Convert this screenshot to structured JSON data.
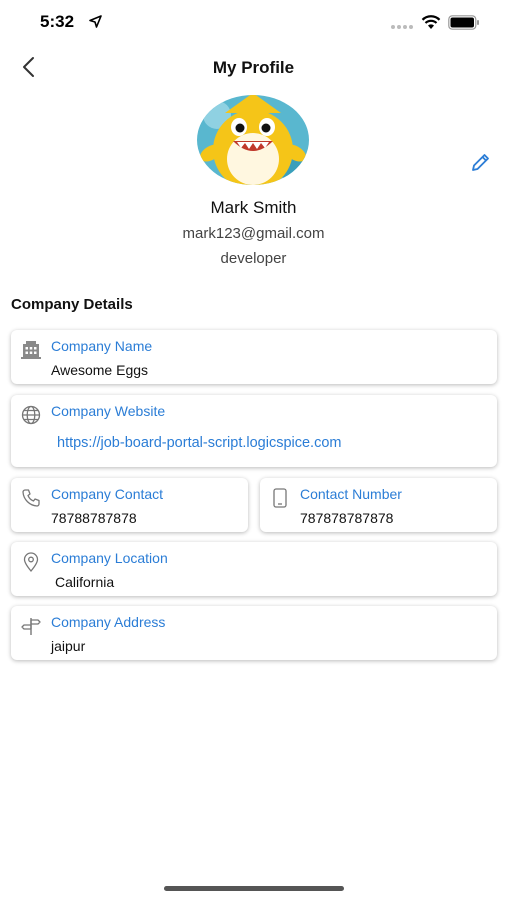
{
  "status_bar": {
    "time": "5:32"
  },
  "nav": {
    "title": "My Profile"
  },
  "profile": {
    "name": "Mark Smith",
    "email": "mark123@gmail.com",
    "role": "developer"
  },
  "company": {
    "section_title": "Company Details",
    "name": {
      "label": "Company Name",
      "value": "Awesome Eggs",
      "icon": "building-icon"
    },
    "website": {
      "label": "Company Website",
      "value": "https://job-board-portal-script.logicspice.com",
      "icon": "globe-icon"
    },
    "contact": {
      "label": "Company Contact",
      "value": "78788787878",
      "icon": "phone-icon"
    },
    "contact_number": {
      "label": "Contact Number",
      "value": "787878787878",
      "icon": "mobile-icon"
    },
    "location": {
      "label": "Company Location",
      "value": "California",
      "icon": "location-pin-icon"
    },
    "address": {
      "label": "Company Address",
      "value": "jaipur",
      "icon": "signpost-icon"
    }
  },
  "colors": {
    "accent": "#2b7dd6",
    "text": "#111111",
    "muted": "#444444"
  }
}
